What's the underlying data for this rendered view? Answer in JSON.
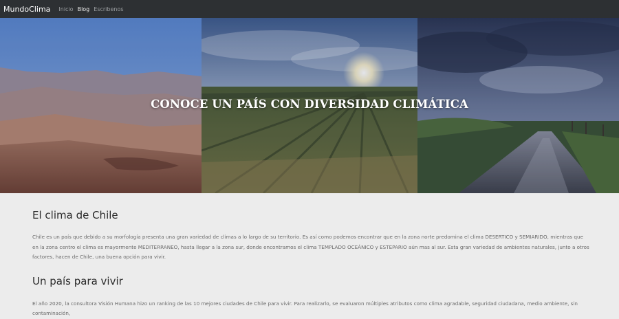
{
  "nav": {
    "brand": "MundoClima",
    "links": [
      {
        "label": "Inicio",
        "active": false
      },
      {
        "label": "Blog",
        "active": true
      },
      {
        "label": "Escribenos",
        "active": false
      }
    ]
  },
  "hero": {
    "title": "CONOCE UN PAÍS CON DIVERSIDAD CLIMÁTICA",
    "images": [
      "desert-mountains",
      "vineyard-sunset",
      "rainy-road"
    ]
  },
  "sections": [
    {
      "title": "El clima de Chile",
      "body": "Chile es un país que debido a su morfología presenta una gran variedad de climas a lo largo de su territorio. Es así como podemos encontrar que en la zona norte predomina el clima DESERTICO y SEMIARIDO, mientras que en la zona centro el clima es mayormente MEDITERRANEO, hasta llegar a la zona sur, donde encontramos el clima TEMPLADO OCEÁNICO y ESTEPARIO aún mas al sur. Esta gran variedad de ambientes naturales, junto a otros factores, hacen de Chile, una buena opción para vivir."
    },
    {
      "title": "Un país para vivir",
      "body": "El año 2020, la consultora Visión Humana hizo un ranking de las 10 mejores ciudades de Chile para vivir. Para realizarlo, se evaluaron múltiples atributos como clima agradable, seguridad ciudadana, medio ambiente, sin contaminación,"
    }
  ],
  "colors": {
    "navbar": "#2d3033",
    "page_bg": "#ececec",
    "heading": "#2a2a2a",
    "body_text": "#6a6a6a"
  }
}
